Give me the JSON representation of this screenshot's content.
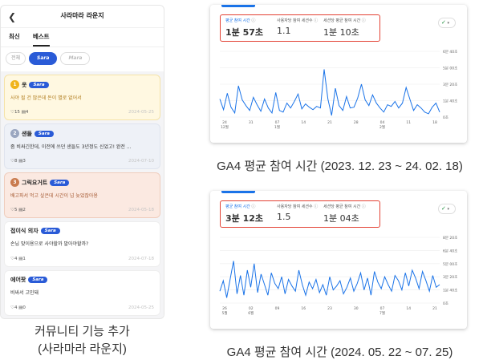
{
  "phone": {
    "title": "사라마라 라운지",
    "tabs": [
      "최신",
      "베스트"
    ],
    "filters": [
      "전체",
      "Sara",
      "Mara"
    ],
    "posts": [
      {
        "rank": "1",
        "title": "옷",
        "tag": "Sara",
        "body": "사야 될 건 많은데 돈이 별로 없어서",
        "likes": "15",
        "comments": "4",
        "date": "2024-05-25"
      },
      {
        "rank": "2",
        "title": "샌들",
        "tag": "Sara",
        "body": "좀 비싸긴한데, 이전에 쓰던 샌들도 3년정도 신었고! 완전 ...",
        "likes": "8",
        "comments": "3",
        "date": "2024-07-10"
      },
      {
        "rank": "3",
        "title": "그릭요거트",
        "tag": "Sara",
        "body": "배고파서 먹고 싶은데 시간이 넘 늦었잖아용",
        "likes": "5",
        "comments": "2",
        "date": "2024-05-18"
      },
      {
        "rank": "",
        "title": "접이식 의자",
        "tag": "Sara",
        "body": "손님 맞이용으로 사야할까 말아야할까?",
        "likes": "4",
        "comments": "1",
        "date": "2024-07-18"
      },
      {
        "rank": "",
        "title": "에어팟",
        "tag": "Sara",
        "body": "비싸서 고민돼",
        "likes": "4",
        "comments": "0",
        "date": "2024-05-25"
      }
    ]
  },
  "captions": {
    "left_line1": "커뮤니티 기능 추가",
    "left_line2": "(사라마라 라운지)",
    "panel1": "GA4 평균 참여 시간 (2023. 12. 23 ~ 24. 02. 18)",
    "panel2": "GA4 평균 참여 시간 (2024. 05. 22 ~ 07. 25)"
  },
  "panels": [
    {
      "metrics": [
        {
          "label": "평균 참여 시간",
          "value": "1분 57초"
        },
        {
          "label": "사용자당 참여 세션수",
          "value": "1.1"
        },
        {
          "label": "세션당 평균 참여 시간",
          "value": "1분 10초"
        }
      ],
      "check_icon": "check-circle-icon",
      "chart_data": {
        "type": "line",
        "y_ticks": [
          "6분 40초",
          "5분 00초",
          "3분 20초",
          "1분 40초",
          "0초"
        ],
        "x_ticks": [
          "24\n12월",
          "31",
          "07\n1월",
          "14",
          "21",
          "28",
          "04\n2월",
          "11",
          "18"
        ],
        "ylim": [
          0,
          400
        ],
        "series": [
          {
            "color": "#1a73e8",
            "values": [
              110,
              45,
              145,
              60,
              25,
              190,
              105,
              70,
              40,
              120,
              75,
              35,
              110,
              55,
              25,
              150,
              40,
              30,
              85,
              55,
              95,
              140,
              50,
              80,
              60,
              45,
              65,
              55,
              290,
              110,
              10,
              175,
              70,
              40,
              125,
              55,
              60,
              115,
              200,
              105,
              70,
              135,
              85,
              55,
              30,
              75,
              65,
              95,
              55,
              85,
              180,
              110,
              40,
              75,
              55,
              30,
              20,
              60,
              85,
              30
            ]
          }
        ]
      }
    },
    {
      "metrics": [
        {
          "label": "평균 참여 시간",
          "value": "3분 12초"
        },
        {
          "label": "사용자당 참여 세션수",
          "value": "1.5"
        },
        {
          "label": "세션당 평균 참여 시간",
          "value": "1분 04초"
        }
      ],
      "check_icon": "check-circle-icon",
      "chart_data": {
        "type": "line",
        "y_ticks": [
          "8분 20초",
          "6분 40초",
          "5분 00초",
          "3분 20초",
          "1분 40초",
          "0초"
        ],
        "x_ticks": [
          "26\n5월",
          "02\n6월",
          "09",
          "16",
          "23",
          "30",
          "07\n7월",
          "14",
          "21"
        ],
        "ylim": [
          0,
          500
        ],
        "series": [
          {
            "color": "#1a73e8",
            "values": [
              90,
              170,
              40,
              180,
              320,
              70,
              210,
              60,
              250,
              120,
              300,
              80,
              220,
              140,
              60,
              230,
              150,
              110,
              200,
              70,
              180,
              130,
              90,
              250,
              140,
              60,
              160,
              110,
              180,
              80,
              140,
              60,
              200,
              100,
              130,
              170,
              70,
              120,
              190,
              90,
              150,
              230,
              100,
              190,
              60,
              240,
              160,
              110,
              200,
              140,
              90,
              210,
              170,
              100,
              230,
              130,
              250,
              190,
              110,
              240,
              170,
              90,
              210,
              120,
              140
            ]
          }
        ]
      }
    }
  ]
}
